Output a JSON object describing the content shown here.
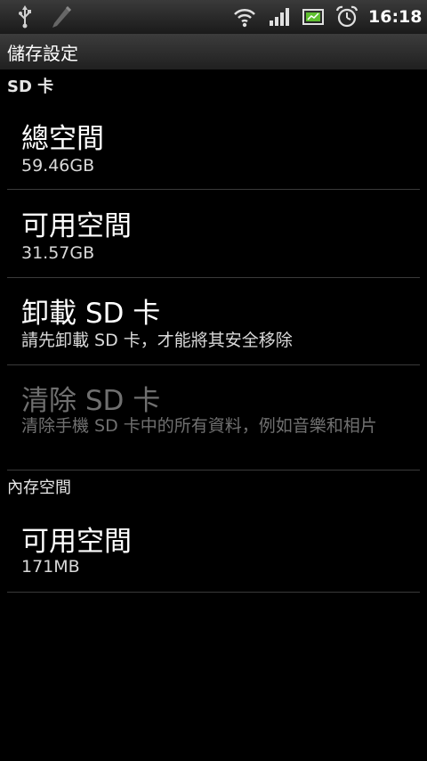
{
  "status_bar": {
    "icons": [
      "usb-icon",
      "pen-icon",
      "wifi-icon",
      "signal-icon",
      "battery-icon",
      "alarm-icon"
    ],
    "time": "16:18"
  },
  "title_bar": {
    "title": "儲存設定"
  },
  "sections": {
    "sd_card": {
      "header": "SD 卡",
      "items": [
        {
          "title": "總空間",
          "summary": "59.46GB"
        },
        {
          "title": "可用空間",
          "summary": "31.57GB"
        },
        {
          "title": "卸載 SD 卡",
          "summary": "請先卸載 SD 卡，才能將其安全移除"
        },
        {
          "title": "清除 SD 卡",
          "summary": "清除手機 SD 卡中的所有資料，例如音樂和相片",
          "enabled": false
        }
      ]
    },
    "internal": {
      "header": "內存空間",
      "items": [
        {
          "title": "可用空間",
          "summary": "171MB"
        }
      ]
    }
  },
  "colors": {
    "background": "#000000",
    "divider": "#3a3a3a",
    "disabled_text": "#707070",
    "battery_green": "#5fbf2f"
  }
}
